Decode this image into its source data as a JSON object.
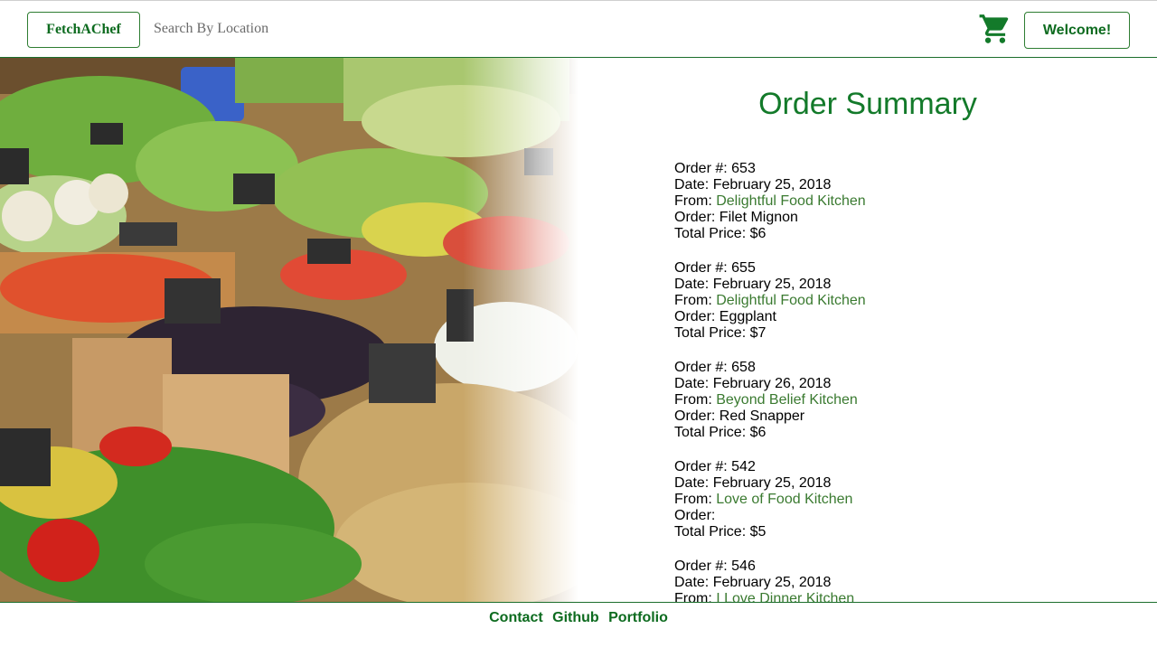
{
  "header": {
    "brand": "FetchAChef",
    "search_placeholder": "Search By Location",
    "cart_icon": "cart-icon",
    "welcome_label": "Welcome!"
  },
  "colors": {
    "brand_green": "#0d6b1f",
    "title_green": "#137a2a",
    "kitchen_link": "#3a7a30"
  },
  "summary": {
    "title": "Order Summary",
    "labels": {
      "order_no": "Order #: ",
      "date": "Date: ",
      "from": "From: ",
      "order": "Order: ",
      "total": "Total Price: "
    },
    "orders": [
      {
        "number": "653",
        "date": "February 25, 2018",
        "kitchen": "Delightful Food Kitchen",
        "item": "Filet Mignon",
        "total": "$6"
      },
      {
        "number": "655",
        "date": "February 25, 2018",
        "kitchen": "Delightful Food Kitchen",
        "item": "Eggplant",
        "total": "$7"
      },
      {
        "number": "658",
        "date": "February 26, 2018",
        "kitchen": "Beyond Belief Kitchen",
        "item": "Red Snapper",
        "total": "$6"
      },
      {
        "number": "542",
        "date": "February 25, 2018",
        "kitchen": "Love of Food Kitchen",
        "item": "",
        "total": "$5"
      },
      {
        "number": "546",
        "date": "February 25, 2018",
        "kitchen": "I Love Dinner Kitchen",
        "item": "",
        "total": ""
      }
    ]
  },
  "footer": {
    "links": [
      "Contact",
      "Github",
      "Portfolio"
    ]
  }
}
